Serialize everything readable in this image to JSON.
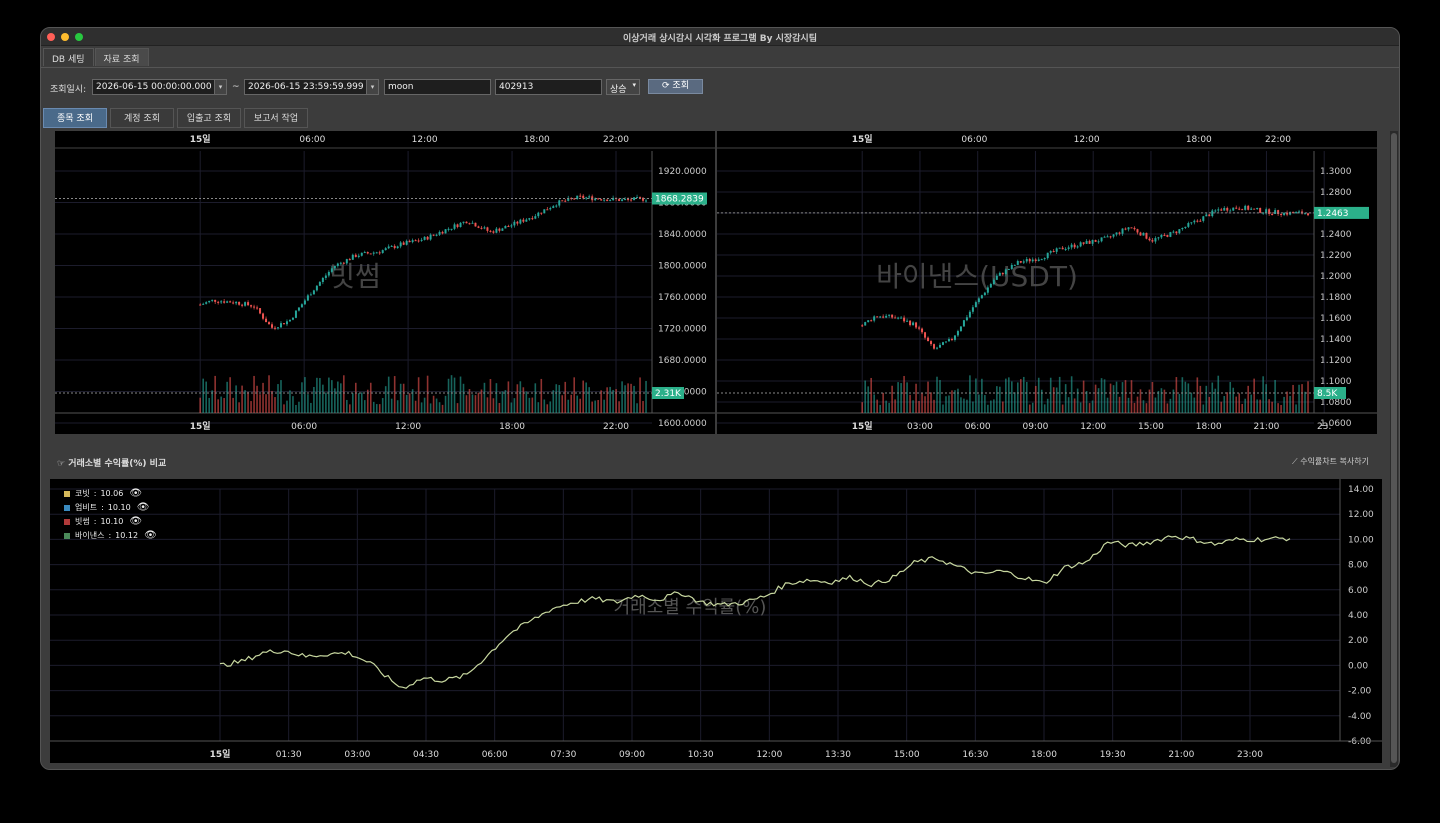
{
  "window": {
    "title": "이상거래 상시감시 시각화 프로그램 By 시장감시팀"
  },
  "main_tabs": [
    {
      "label": "DB 세팅"
    },
    {
      "label": "자료 조회"
    }
  ],
  "toolbar": {
    "date_label": "조회일시:",
    "start_datetime": "2026-06-15 00:00:00.000",
    "separator": "~",
    "end_datetime": "2026-06-15 23:59:59.999",
    "user_value": "moon",
    "code_value": "402913",
    "direction_value": "상승",
    "search_button": "조회"
  },
  "sub_tabs": [
    {
      "label": "종목 조회"
    },
    {
      "label": "계정 조회"
    },
    {
      "label": "입출고 조회"
    },
    {
      "label": "보고서 작업"
    }
  ],
  "returns_section": {
    "title": "거래소별 수익률(%) 비교",
    "copy_button": "수익률차트 복사하기"
  },
  "colors": {
    "accent_tag": "#2bb08a",
    "line_series": "#c8d8a0",
    "bg": "#000000"
  },
  "chart_data": [
    {
      "type": "candlestick",
      "watermark": "빗썸",
      "x_ticks_top": [
        "15일",
        "06:00",
        "12:00",
        "18:00",
        "22:00"
      ],
      "x_ticks_bottom": [
        "15일",
        "06:00",
        "12:00",
        "18:00",
        "22:00"
      ],
      "y_ticks": [
        "1920.0000",
        "1880.0000",
        "1840.0000",
        "1800.0000",
        "1760.0000",
        "1720.0000",
        "1680.0000",
        "1640.0000",
        "1600.0000"
      ],
      "ylim": [
        1600,
        1920
      ],
      "last_price_tag": "1868.2839",
      "volume_tag": "2.31K",
      "close_path": [
        [
          0,
          1722
        ],
        [
          0.03,
          1728
        ],
        [
          0.08,
          1725
        ],
        [
          0.12,
          1720
        ],
        [
          0.16,
          1690
        ],
        [
          0.2,
          1700
        ],
        [
          0.25,
          1740
        ],
        [
          0.3,
          1775
        ],
        [
          0.35,
          1790
        ],
        [
          0.4,
          1795
        ],
        [
          0.45,
          1805
        ],
        [
          0.5,
          1812
        ],
        [
          0.55,
          1825
        ],
        [
          0.6,
          1838
        ],
        [
          0.65,
          1822
        ],
        [
          0.7,
          1832
        ],
        [
          0.75,
          1845
        ],
        [
          0.8,
          1862
        ],
        [
          0.85,
          1870
        ],
        [
          0.9,
          1868
        ],
        [
          0.95,
          1866
        ],
        [
          1,
          1868
        ]
      ]
    },
    {
      "type": "candlestick",
      "watermark": "바이낸스(USDT)",
      "x_ticks_top": [
        "15일",
        "06:00",
        "12:00",
        "18:00",
        "22:00"
      ],
      "x_ticks_bottom": [
        "15일",
        "03:00",
        "06:00",
        "09:00",
        "12:00",
        "15:00",
        "18:00",
        "21:00",
        "23:"
      ],
      "y_ticks": [
        "1.3000",
        "1.2800",
        "1.2600",
        "1.2400",
        "1.2200",
        "1.2000",
        "1.1800",
        "1.1600",
        "1.1400",
        "1.1200",
        "1.1000",
        "1.0800",
        "1.0600"
      ],
      "ylim": [
        1.06,
        1.3
      ],
      "last_price_tag": "1.2463",
      "volume_tag": "8.5K",
      "close_path": [
        [
          0,
          1.13
        ],
        [
          0.03,
          1.14
        ],
        [
          0.08,
          1.138
        ],
        [
          0.12,
          1.13
        ],
        [
          0.16,
          1.105
        ],
        [
          0.2,
          1.115
        ],
        [
          0.25,
          1.15
        ],
        [
          0.3,
          1.18
        ],
        [
          0.35,
          1.195
        ],
        [
          0.4,
          1.2
        ],
        [
          0.45,
          1.21
        ],
        [
          0.5,
          1.215
        ],
        [
          0.55,
          1.22
        ],
        [
          0.6,
          1.232
        ],
        [
          0.65,
          1.218
        ],
        [
          0.7,
          1.226
        ],
        [
          0.75,
          1.238
        ],
        [
          0.8,
          1.25
        ],
        [
          0.85,
          1.252
        ],
        [
          0.9,
          1.248
        ],
        [
          0.95,
          1.246
        ],
        [
          1,
          1.2463
        ]
      ]
    },
    {
      "type": "line",
      "watermark": "거래소별 수익률(%)",
      "x_ticks": [
        "15일",
        "01:30",
        "03:00",
        "04:30",
        "06:00",
        "07:30",
        "09:00",
        "10:30",
        "12:00",
        "13:30",
        "15:00",
        "16:30",
        "18:00",
        "19:30",
        "21:00",
        "23:00"
      ],
      "y_ticks": [
        "14.00",
        "12.00",
        "10.00",
        "8.00",
        "6.00",
        "4.00",
        "2.00",
        "0.00",
        "-2.00",
        "-4.00",
        "-6.00"
      ],
      "ylim": [
        -6,
        14
      ],
      "series": [
        {
          "name": "코빗",
          "value": "10.06",
          "color": "#d4b85a"
        },
        {
          "name": "업비트",
          "value": "10.10",
          "color": "#3a8abf"
        },
        {
          "name": "빗썸",
          "value": "10.10",
          "color": "#b03a3a"
        },
        {
          "name": "바이낸스",
          "value": "10.12",
          "color": "#4a8a5a"
        }
      ],
      "line_path": [
        [
          0,
          0
        ],
        [
          0.02,
          0.3
        ],
        [
          0.04,
          1.0
        ],
        [
          0.06,
          1.2
        ],
        [
          0.08,
          0.7
        ],
        [
          0.1,
          0.9
        ],
        [
          0.12,
          1.0
        ],
        [
          0.14,
          0.2
        ],
        [
          0.16,
          -1.2
        ],
        [
          0.17,
          -1.8
        ],
        [
          0.19,
          -1.0
        ],
        [
          0.21,
          -1.2
        ],
        [
          0.23,
          -0.8
        ],
        [
          0.25,
          0.8
        ],
        [
          0.27,
          2.5
        ],
        [
          0.29,
          3.5
        ],
        [
          0.31,
          4.5
        ],
        [
          0.33,
          5.0
        ],
        [
          0.35,
          5.3
        ],
        [
          0.37,
          5.0
        ],
        [
          0.39,
          5.6
        ],
        [
          0.41,
          5.2
        ],
        [
          0.43,
          5.8
        ],
        [
          0.45,
          5.0
        ],
        [
          0.47,
          4.8
        ],
        [
          0.49,
          5.0
        ],
        [
          0.51,
          5.5
        ],
        [
          0.53,
          6.5
        ],
        [
          0.55,
          6.8
        ],
        [
          0.57,
          6.6
        ],
        [
          0.59,
          7.0
        ],
        [
          0.61,
          6.4
        ],
        [
          0.63,
          7.0
        ],
        [
          0.65,
          8.2
        ],
        [
          0.67,
          8.5
        ],
        [
          0.69,
          7.8
        ],
        [
          0.71,
          7.2
        ],
        [
          0.73,
          7.5
        ],
        [
          0.75,
          7.0
        ],
        [
          0.77,
          6.5
        ],
        [
          0.79,
          7.8
        ],
        [
          0.81,
          8.2
        ],
        [
          0.83,
          9.8
        ],
        [
          0.85,
          9.5
        ],
        [
          0.87,
          9.8
        ],
        [
          0.89,
          10.3
        ],
        [
          0.91,
          10.0
        ],
        [
          0.93,
          9.6
        ],
        [
          0.95,
          10.0
        ],
        [
          0.97,
          10.0
        ],
        [
          1,
          10.1
        ]
      ]
    }
  ]
}
